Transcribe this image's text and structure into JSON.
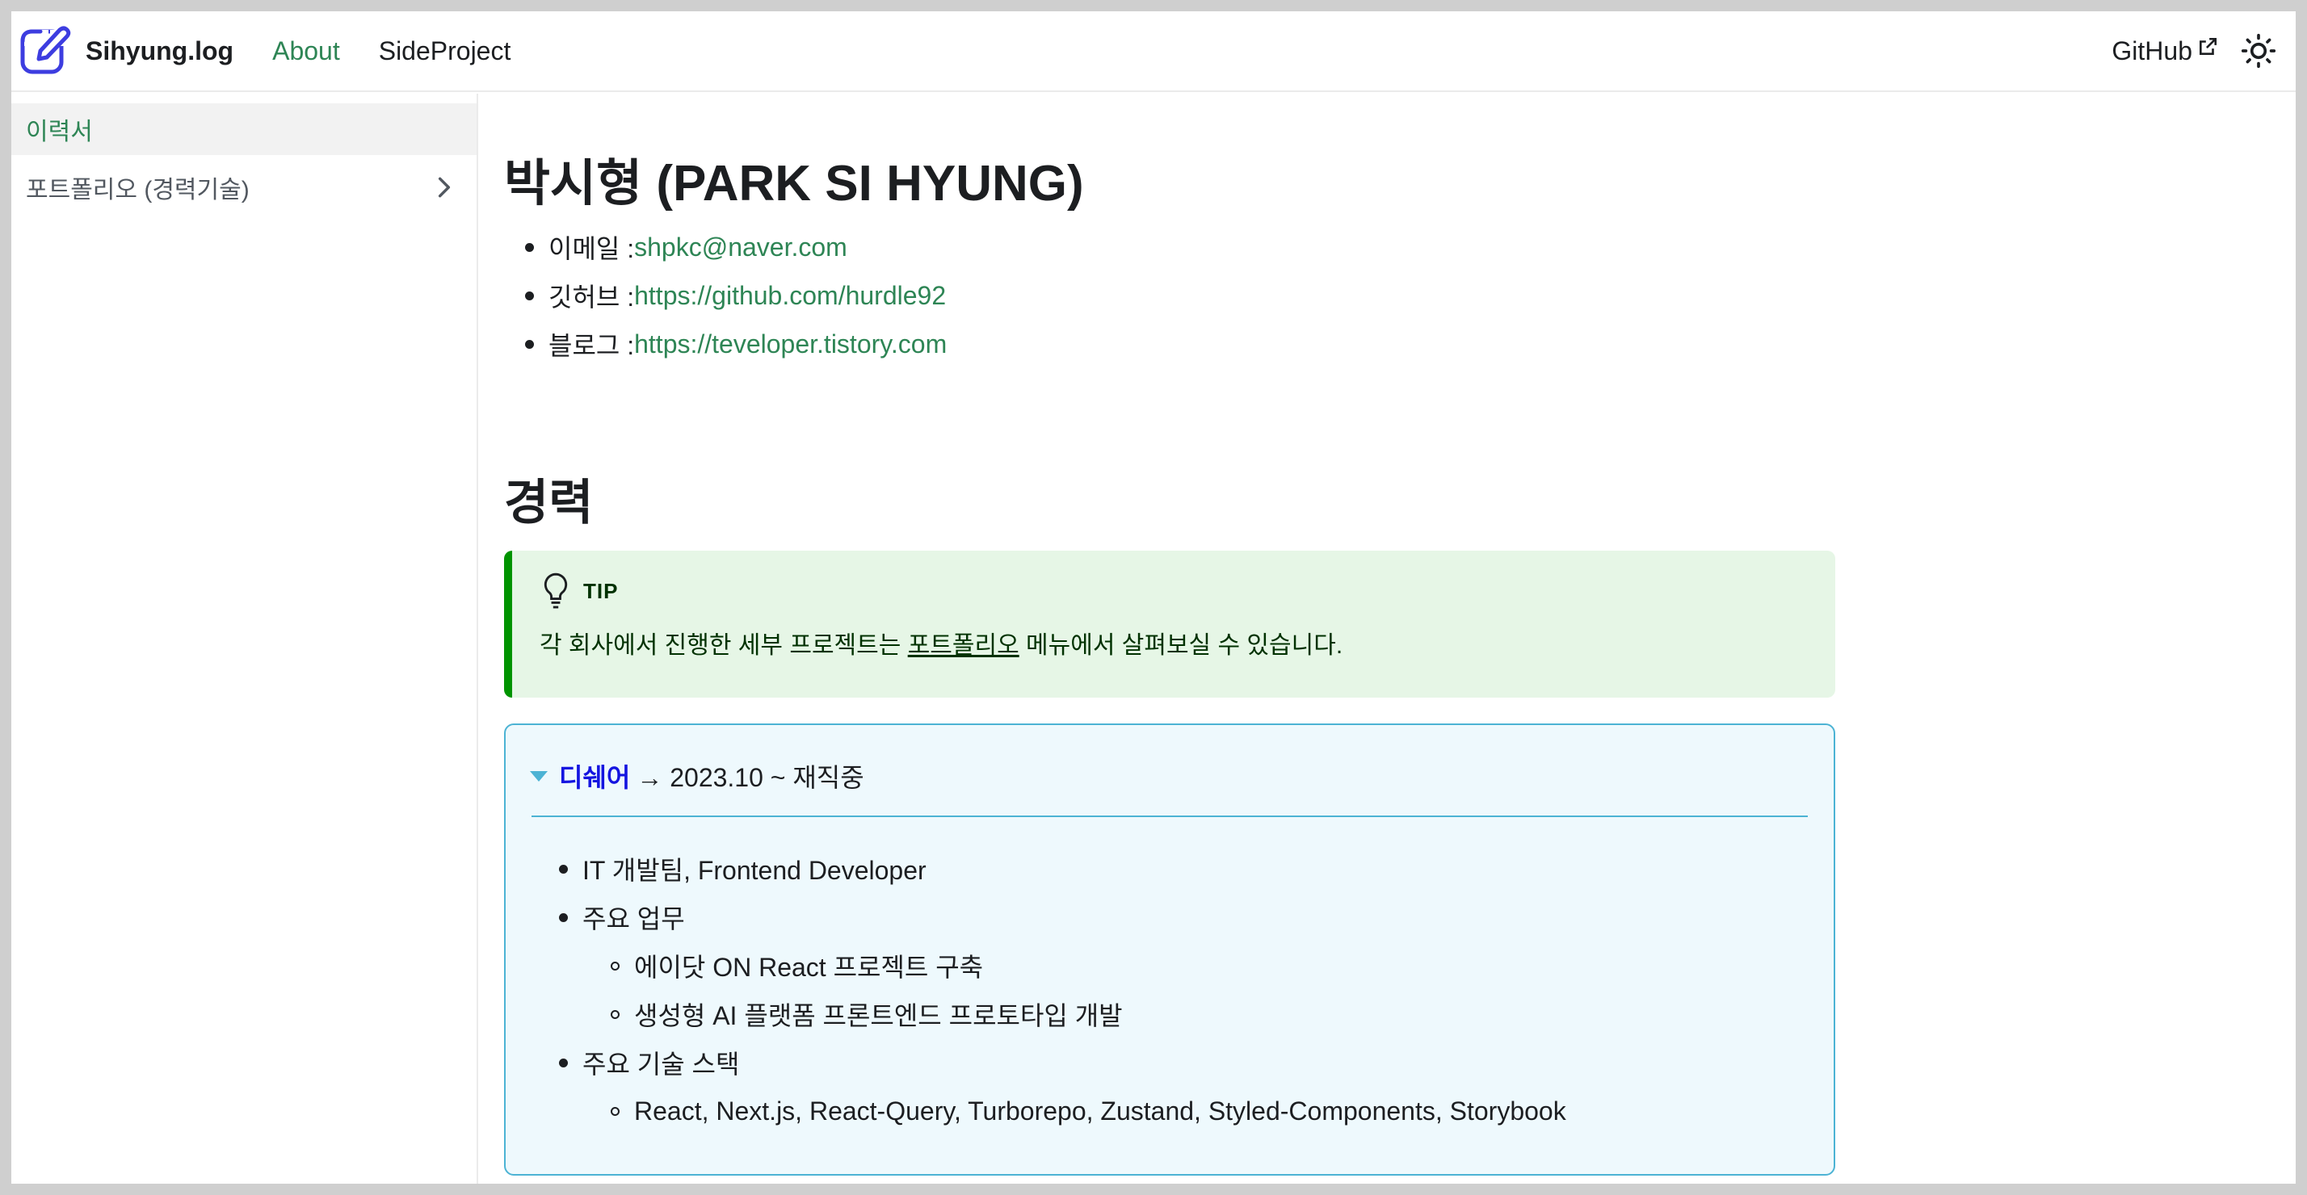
{
  "navbar": {
    "brand_title": "Sihyung.log",
    "links": [
      {
        "label": "About",
        "active": true
      },
      {
        "label": "SideProject",
        "active": false
      }
    ],
    "github_label": "GitHub",
    "accent_color": "#2e8555",
    "logo_color": "#3d3de0"
  },
  "sidebar": {
    "items": [
      {
        "label": "이력서",
        "active": true
      },
      {
        "label": "포트폴리오 (경력기술)",
        "active": false,
        "icon": "chevron-right-icon"
      }
    ]
  },
  "main": {
    "name_title": "박시형 (PARK SI HYUNG)",
    "contacts": [
      {
        "label": "이메일 : ",
        "value": "shpkc@naver.com"
      },
      {
        "label": "깃허브 : ",
        "value": "https://github.com/hurdle92"
      },
      {
        "label": "블로그 : ",
        "value": "https://teveloper.tistory.com"
      }
    ],
    "section_title": "경력",
    "tip": {
      "title": "TIP",
      "text_before": "각 회사에서 진행한 세부 프로젝트는 ",
      "link": "포트폴리오",
      "text_after": " 메뉴에서 살펴보실 수 있습니다.",
      "icon": "lightbulb-icon"
    },
    "career": {
      "company": "디쉐어",
      "period": "→ 2023.10 ~ 재직중",
      "role": "IT 개발팀, Frontend Developer",
      "duties_label": "주요 업무",
      "duties": [
        "에이닷 ON React 프로젝트 구축",
        "생성형 AI 플랫폼 프론트엔드 프로토타입 개발"
      ],
      "stack_label": "주요 기술 스택",
      "stack": [
        "React, Next.js, React-Query, Turborepo, Zustand, Styled-Components, Storybook"
      ]
    }
  }
}
